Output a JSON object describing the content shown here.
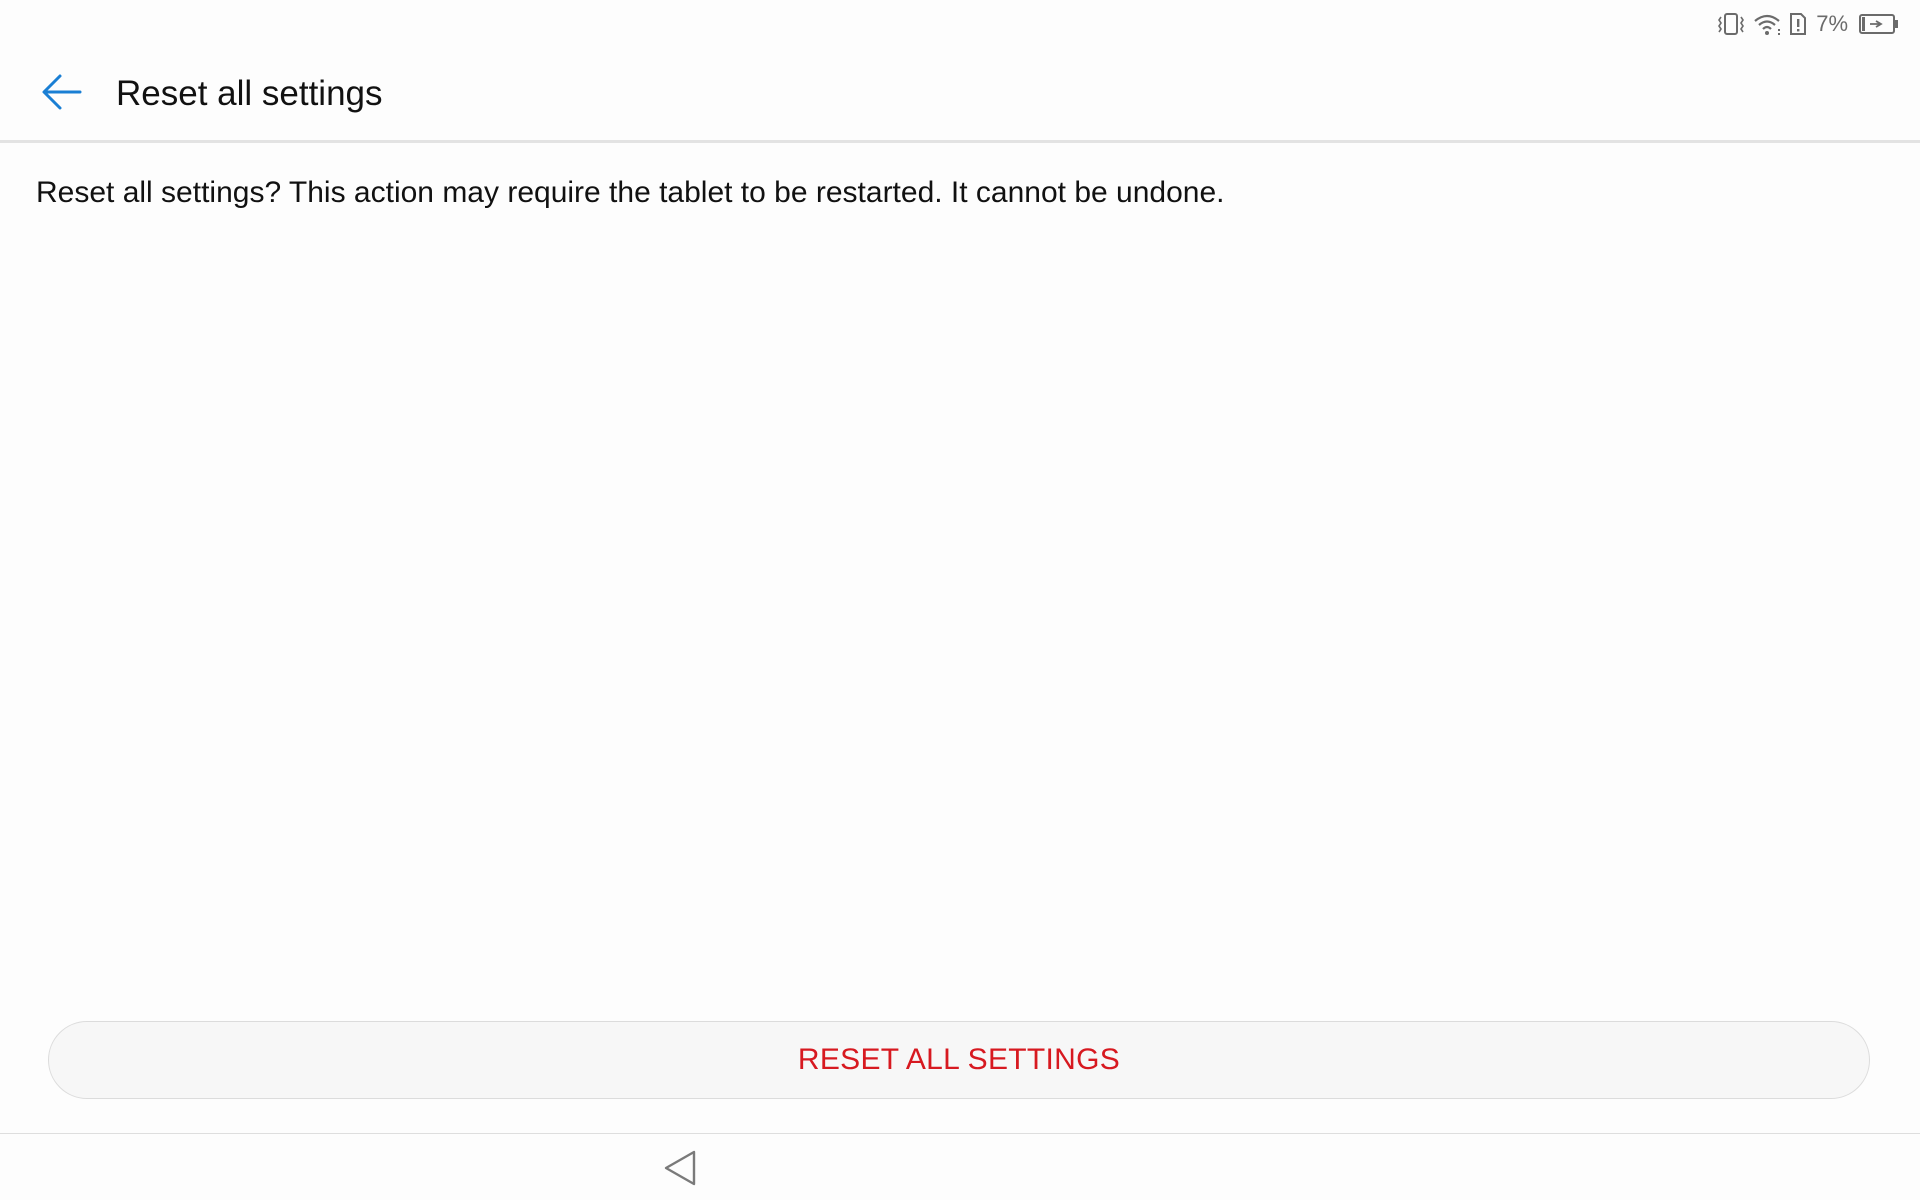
{
  "status_bar": {
    "icons": [
      "vibrate-icon",
      "wifi-icon",
      "sim-alert-icon",
      "battery-charging-icon"
    ],
    "battery_percent": "7%"
  },
  "header": {
    "title": "Reset all settings",
    "back_icon": "arrow-left-icon",
    "accent_color": "#1a7fd4"
  },
  "main": {
    "message": "Reset all settings? This action may require the tablet to be restarted. It cannot be undone."
  },
  "actions": {
    "reset_label": "RESET ALL SETTINGS",
    "reset_color": "#d71920"
  },
  "nav_bar": {
    "back_icon": "triangle-back-icon"
  }
}
